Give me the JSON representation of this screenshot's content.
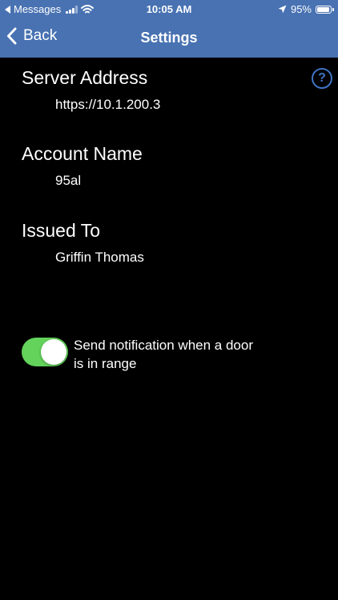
{
  "status_bar": {
    "back_app": "Messages",
    "time": "10:05 AM",
    "battery": "95%",
    "battery_level": 0.95
  },
  "nav": {
    "back_label": "Back",
    "title": "Settings"
  },
  "fields": [
    {
      "label": "Server Address",
      "value": "https://10.1.200.3"
    },
    {
      "label": "Account Name",
      "value": "95al"
    },
    {
      "label": "Issued To",
      "value": "Griffin Thomas"
    }
  ],
  "help_icon": {
    "glyph": "?",
    "color": "#3F74C4"
  },
  "notification_toggle": {
    "label": "Send notification when a door is in range",
    "on": true,
    "color": "#63D35B"
  },
  "colors": {
    "nav_bar": "#4872B2",
    "background": "#000000"
  }
}
